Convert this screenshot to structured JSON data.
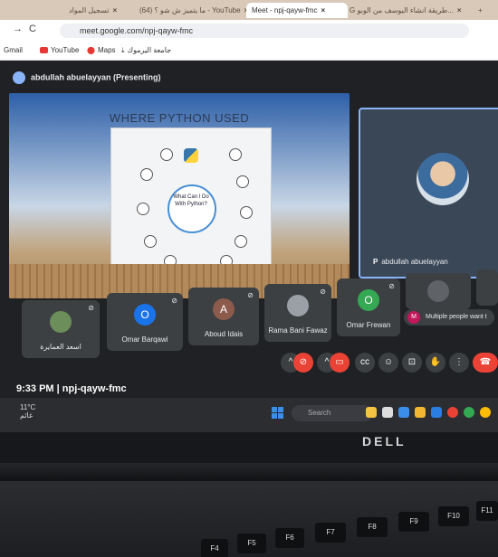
{
  "browser": {
    "tabs": [
      {
        "label": "تسجيل المواد",
        "active": false
      },
      {
        "label": "(64) ما يتميز ش شو ؟ - YouTube",
        "active": false
      },
      {
        "label": "Meet - npj-qayw-fmc",
        "active": true
      },
      {
        "label": "G طريقة انشاء اليوسف من الوبو...",
        "active": false
      }
    ],
    "new_tab": "+",
    "url": "meet.google.com/npj-qayw-fmc",
    "bookmarks": [
      "Gmail",
      "YouTube",
      "Maps",
      "جامعة اليرموك"
    ]
  },
  "meet": {
    "presenter_label": "abdullah abuelayyan (Presenting)",
    "slide": {
      "title": "WHERE PYTHON USED",
      "poster_center": "What Can I Do With Python?"
    },
    "self_view": {
      "name": "abdullah abuelayyan"
    },
    "participants": [
      {
        "name": "اسعد العمايرة",
        "avatar": "",
        "color": "#6b8e5a"
      },
      {
        "name": "Omar Barqawi",
        "avatar": "O",
        "color": "#1a73e8"
      },
      {
        "name": "Aboud Idais",
        "avatar": "A",
        "color": "#8d5b4c"
      },
      {
        "name": "Rama Bani Fawaz",
        "avatar": "",
        "color": "#9aa0a6"
      },
      {
        "name": "Omar Frewan",
        "avatar": "O",
        "color": "#34a853"
      },
      {
        "name": "",
        "avatar": "",
        "color": "#5f6368"
      }
    ],
    "multiple_people": {
      "badge": "M",
      "text": "Multiple people want t"
    },
    "meeting_info": "9:33 PM  |  npj-qayw-fmc"
  },
  "taskbar": {
    "weather_temp": "11°C",
    "weather_desc": "غائم",
    "search_placeholder": "Search"
  },
  "laptop": {
    "brand": "DELL",
    "keys": [
      "F4",
      "F5",
      "F6",
      "F7",
      "F8",
      "F9",
      "F10",
      "F11"
    ]
  },
  "colors": {
    "meet_bg": "#202124",
    "accent": "#8ab4f8",
    "end_call": "#ea4335"
  }
}
